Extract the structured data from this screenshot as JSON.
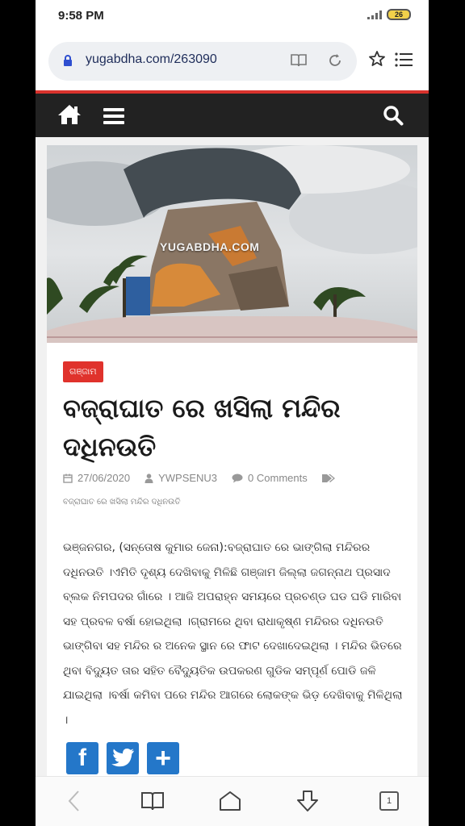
{
  "status_bar": {
    "time": "9:58 PM",
    "battery": "26"
  },
  "browser": {
    "url": "yugabdha.com/263090",
    "tab_count": "1"
  },
  "hero": {
    "watermark": "YUGABDHA.COM"
  },
  "article": {
    "category": "ଗଞ୍ଜାମ",
    "title": "ବଜ୍ରାଘାତ ରେ ଖସିଲା ମନ୍ଦିର ଦଧିନଉତି",
    "date": "27/06/2020",
    "author": "YWPSENU3",
    "comments": "0 Comments",
    "tag": "ବଜ୍ରାଘାତ ରେ ଖସିଲା ମନ୍ଦିର ଦଧିନଉତି",
    "body": "ଭଞ୍ଜନଗର, (ସନ୍ତୋଷ କୁମାର ଜେନା):ବଜ୍ରାଘାତ ରେ ଭାଙ୍ଗିଲା ମନ୍ଦିରର ଦଧିନଉତି ।ଏମିତି ଦୃଶ୍ୟ ଦେଖିବାକୁ ମିଳିଛି ଗଞ୍ଜାମ ଜିଲ୍ଲା ଜଗନ୍ନାଥ ପ୍ରସାଦ ବ୍ଲକ ନିମପଦର ଗାଁରେ । ଆଜି ଅପରାହ୍ନ ସମୟରେ ପ୍ରଚଣ୍ଡ ଘଡ ଘଡି ମାରିବା ସହ ପ୍ରବଳ ବର୍ଷା ହୋଇଥିଲା ।ଗ୍ରାମରେ ଥିବା ରାଧାକୃଷ୍ଣ ମନ୍ଦିରର ଦଧିନଉତି ଭାଙ୍ଗିବା ସହ ମନ୍ଦିର ର ଅନେକ ସ୍ଥାନ ରେ ଫାଟ ଦେଖାଦେଇଥିଲା । ମନ୍ଦିର ଭିତରେ ଥିବା ବିଦ୍ୟୁତ ତାର ସହିତ ବୈଦ୍ୟୁତିକ ଉପକରଣ ଗୁଡିକ ସମ୍ପୂର୍ଣ ପୋଡି ଜଳି ଯାଇଥିଲା ।ବର୍ଷା କମିବା ପରେ ମନ୍ଦିର ଆଗରେ ଲୋକଙ୍କ ଭିଡ଼ ଦେଖିବାକୁ ମିଳିଥିଲା ।"
  },
  "share": {
    "facebook": "f",
    "plus": "+"
  },
  "colors": {
    "accent_red": "#e0322c",
    "nav_dark": "#222222",
    "share_blue": "#2477c9"
  }
}
